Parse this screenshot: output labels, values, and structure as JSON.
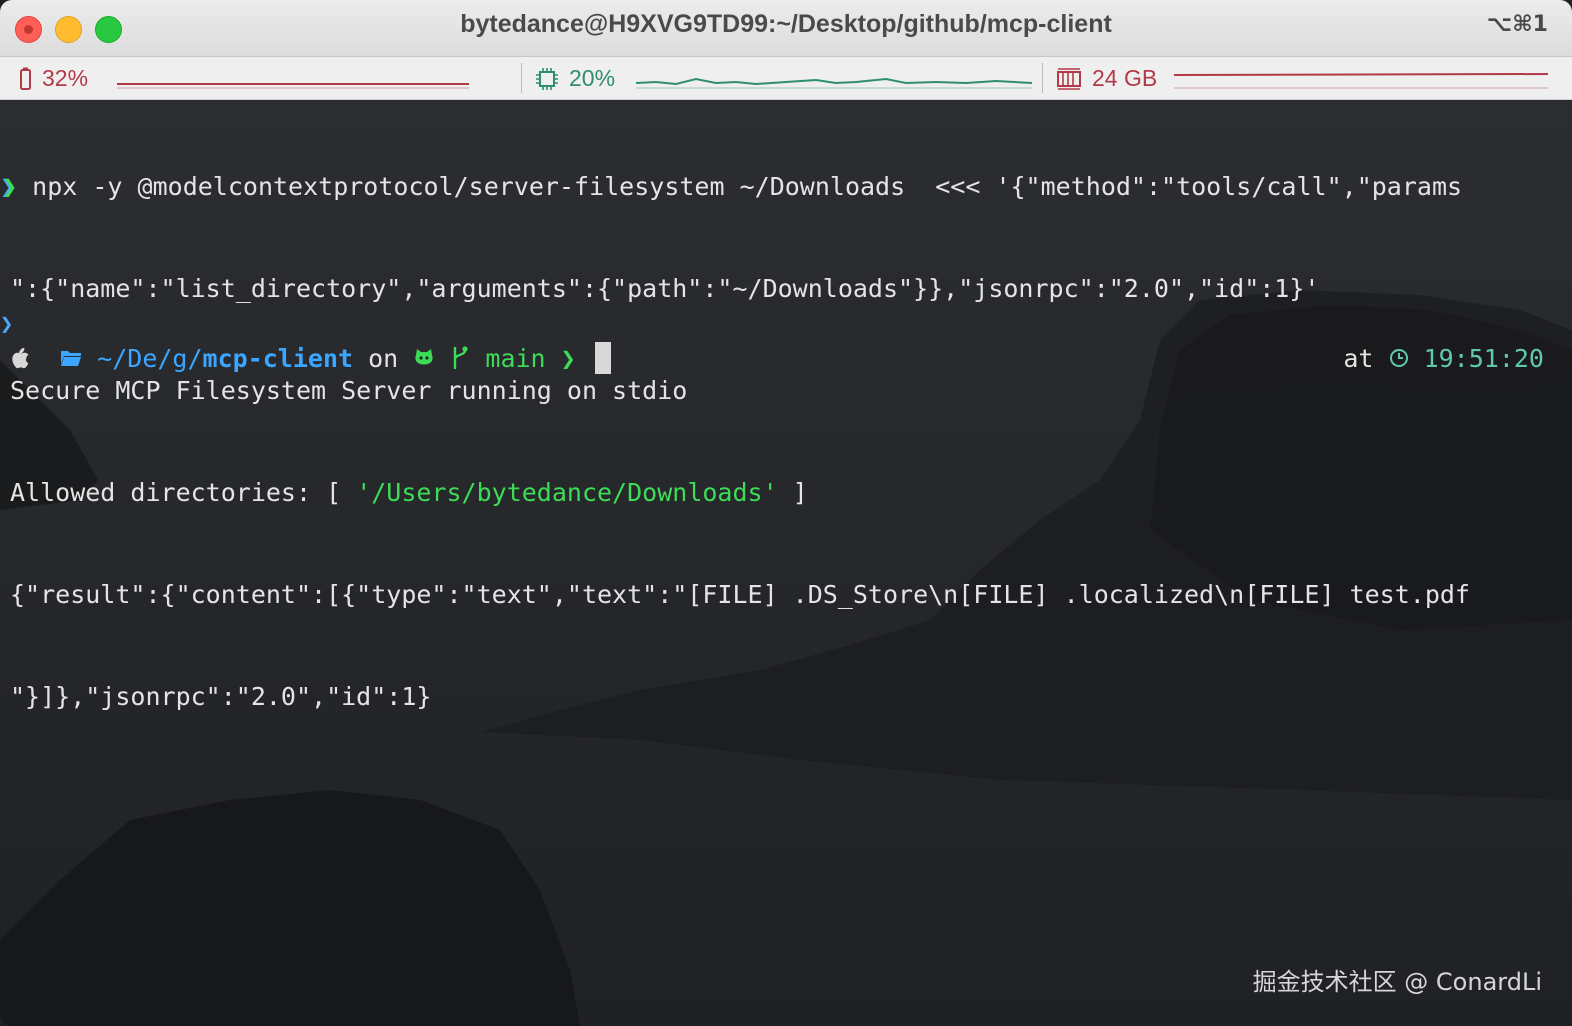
{
  "window": {
    "title": "bytedance@H9XVG9TD99:~/Desktop/github/mcp-client",
    "shortcut": "⌥⌘1"
  },
  "status": {
    "battery": "32%",
    "cpu": "20%",
    "memory": "24 GB"
  },
  "terminal": {
    "lines": [
      {
        "chev": "❯",
        "text": " npx -y @modelcontextprotocol/server-filesystem ~/Downloads  <<< '{\"method\":\"tools/call\",\"params"
      },
      {
        "text": "\":{\"name\":\"list_directory\",\"arguments\":{\"path\":\"~/Downloads\"}},\"jsonrpc\":\"2.0\",\"id\":1}'"
      },
      {
        "text": "Secure MCP Filesystem Server running on stdio"
      },
      {
        "text": "Allowed directories: [ ",
        "green": "'/Users/bytedance/Downloads'",
        "tail": " ]"
      },
      {
        "text": "{\"result\":{\"content\":[{\"type\":\"text\",\"text\":\"[FILE] .DS_Store\\n[FILE] .localized\\n[FILE] test.pdf"
      },
      {
        "text": "\"}]},\"jsonrpc\":\"2.0\",\"id\":1}"
      }
    ],
    "small_chev": "❯",
    "prompt": {
      "path_prefix": "~/De/g/",
      "dir": "mcp-client",
      "on": " on ",
      "branch": "main",
      "arrow": "❯"
    },
    "rprompt": {
      "at": "at ",
      "time": "19:51:20"
    }
  },
  "watermark": "掘金技术社区 @ ConardLi",
  "colors": {
    "prompt_blue": "#3aa6ff",
    "prompt_green": "#3ddc57",
    "battery_red": "#b23a48",
    "cpu_green": "#2f8f6a"
  }
}
